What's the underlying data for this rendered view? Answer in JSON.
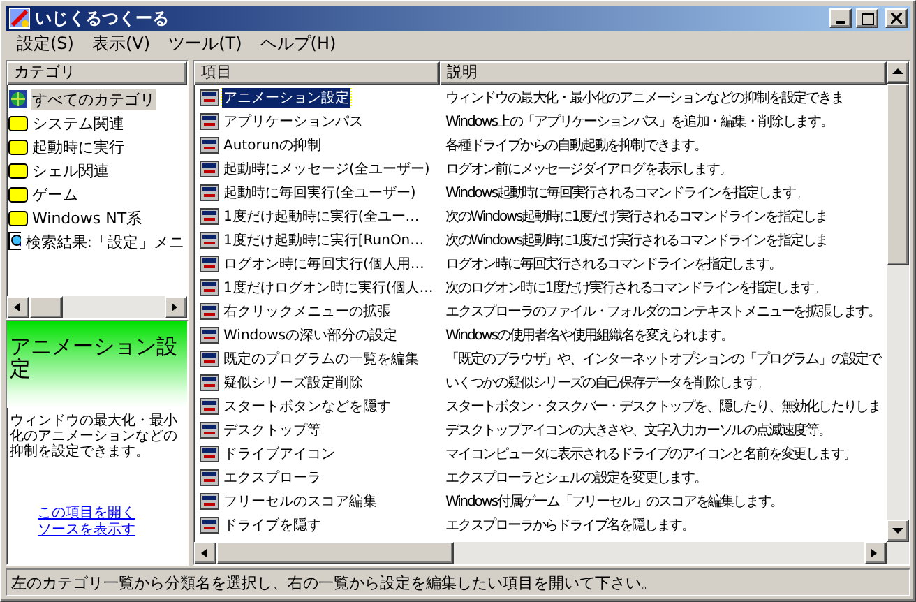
{
  "window": {
    "title": "いじくるつくーる"
  },
  "menu": [
    "設定(S)",
    "表示(V)",
    "ツール(T)",
    "ヘルプ(H)"
  ],
  "categories": {
    "header": "カテゴリ",
    "items": [
      {
        "label": "すべてのカテゴリ",
        "kind": "all",
        "selected": true
      },
      {
        "label": "システム関連",
        "kind": "folder",
        "selected": false
      },
      {
        "label": "起動時に実行",
        "kind": "folder",
        "selected": false
      },
      {
        "label": "シェル関連",
        "kind": "folder",
        "selected": false
      },
      {
        "label": "ゲーム",
        "kind": "folder",
        "selected": false
      },
      {
        "label": "Windows NT系",
        "kind": "folder",
        "selected": false
      },
      {
        "label": "検索結果:「設定」メニ",
        "kind": "search",
        "selected": false
      }
    ]
  },
  "info": {
    "title": "アニメーション設定",
    "description": "ウィンドウの最大化・最小化のアニメーションなどの抑制を設定できます。",
    "links": [
      "この項目を開く",
      "ソースを表示す"
    ]
  },
  "table": {
    "columns": [
      "項目",
      "説明"
    ],
    "rows": [
      {
        "item": "アニメーション設定",
        "description": "ウィンドウの最大化・最小化のアニメーションなどの抑制を設定できま",
        "selected": true
      },
      {
        "item": "アプリケーションパス",
        "description": "Windows上の「アプリケーションパス」を追加・編集・削除します。",
        "selected": false
      },
      {
        "item": "Autorunの抑制",
        "description": "各種ドライブからの自動起動を抑制できます。",
        "selected": false
      },
      {
        "item": "起動時にメッセージ(全ユーザー)",
        "description": "ログオン前にメッセージダイアログを表示します。",
        "selected": false
      },
      {
        "item": "起動時に毎回実行(全ユーザー)",
        "description": "Windows起動時に毎回実行されるコマンドラインを指定します。",
        "selected": false
      },
      {
        "item": "1度だけ起動時に実行(全ユー…",
        "description": "次のWindows起動時に1度だけ実行されるコマンドラインを指定しま",
        "selected": false
      },
      {
        "item": "1度だけ起動時に実行[RunOn…",
        "description": "次のWindows起動時に1度だけ実行されるコマンドラインを指定しま",
        "selected": false
      },
      {
        "item": "ログオン時に毎回実行(個人用…",
        "description": "ログオン時に毎回実行されるコマンドラインを指定します。",
        "selected": false
      },
      {
        "item": "1度だけログオン時に実行(個人…",
        "description": "次のログオン時に1度だけ実行されるコマンドラインを指定します。",
        "selected": false
      },
      {
        "item": "右クリックメニューの拡張",
        "description": "エクスプローラのファイル・フォルダのコンテキストメニューを拡張します。",
        "selected": false
      },
      {
        "item": "Windowsの深い部分の設定",
        "description": "Windowsの使用者名や使用組織名を変えられます。",
        "selected": false
      },
      {
        "item": "既定のプログラムの一覧を編集",
        "description": "「既定のブラウザ」や、インターネットオプションの「プログラム」の設定で",
        "selected": false
      },
      {
        "item": "疑似シリーズ設定削除",
        "description": "いくつかの疑似シリーズの自己保存データを削除します。",
        "selected": false
      },
      {
        "item": "スタートボタンなどを隠す",
        "description": "スタートボタン・タスクバー・デスクトップを、隠したり、無効化したりしま",
        "selected": false
      },
      {
        "item": "デスクトップ等",
        "description": "デスクトップアイコンの大きさや、文字入力カーソルの点滅速度等。",
        "selected": false
      },
      {
        "item": "ドライブアイコン",
        "description": "マイコンピュータに表示されるドライブのアイコンと名前を変更します。",
        "selected": false
      },
      {
        "item": "エクスプローラ",
        "description": "エクスプローラとシェルの設定を変更します。",
        "selected": false
      },
      {
        "item": "フリーセルのスコア編集",
        "description": "Windows付属ゲーム「フリーセル」のスコアを編集します。",
        "selected": false
      },
      {
        "item": "ドライブを隠す",
        "description": "エクスプローラからドライブ名を隠します。",
        "selected": false
      }
    ]
  },
  "status_bar": "左のカテゴリ一覧から分類名を選択し、右の一覧から設定を編集したい項目を開いて下さい。"
}
